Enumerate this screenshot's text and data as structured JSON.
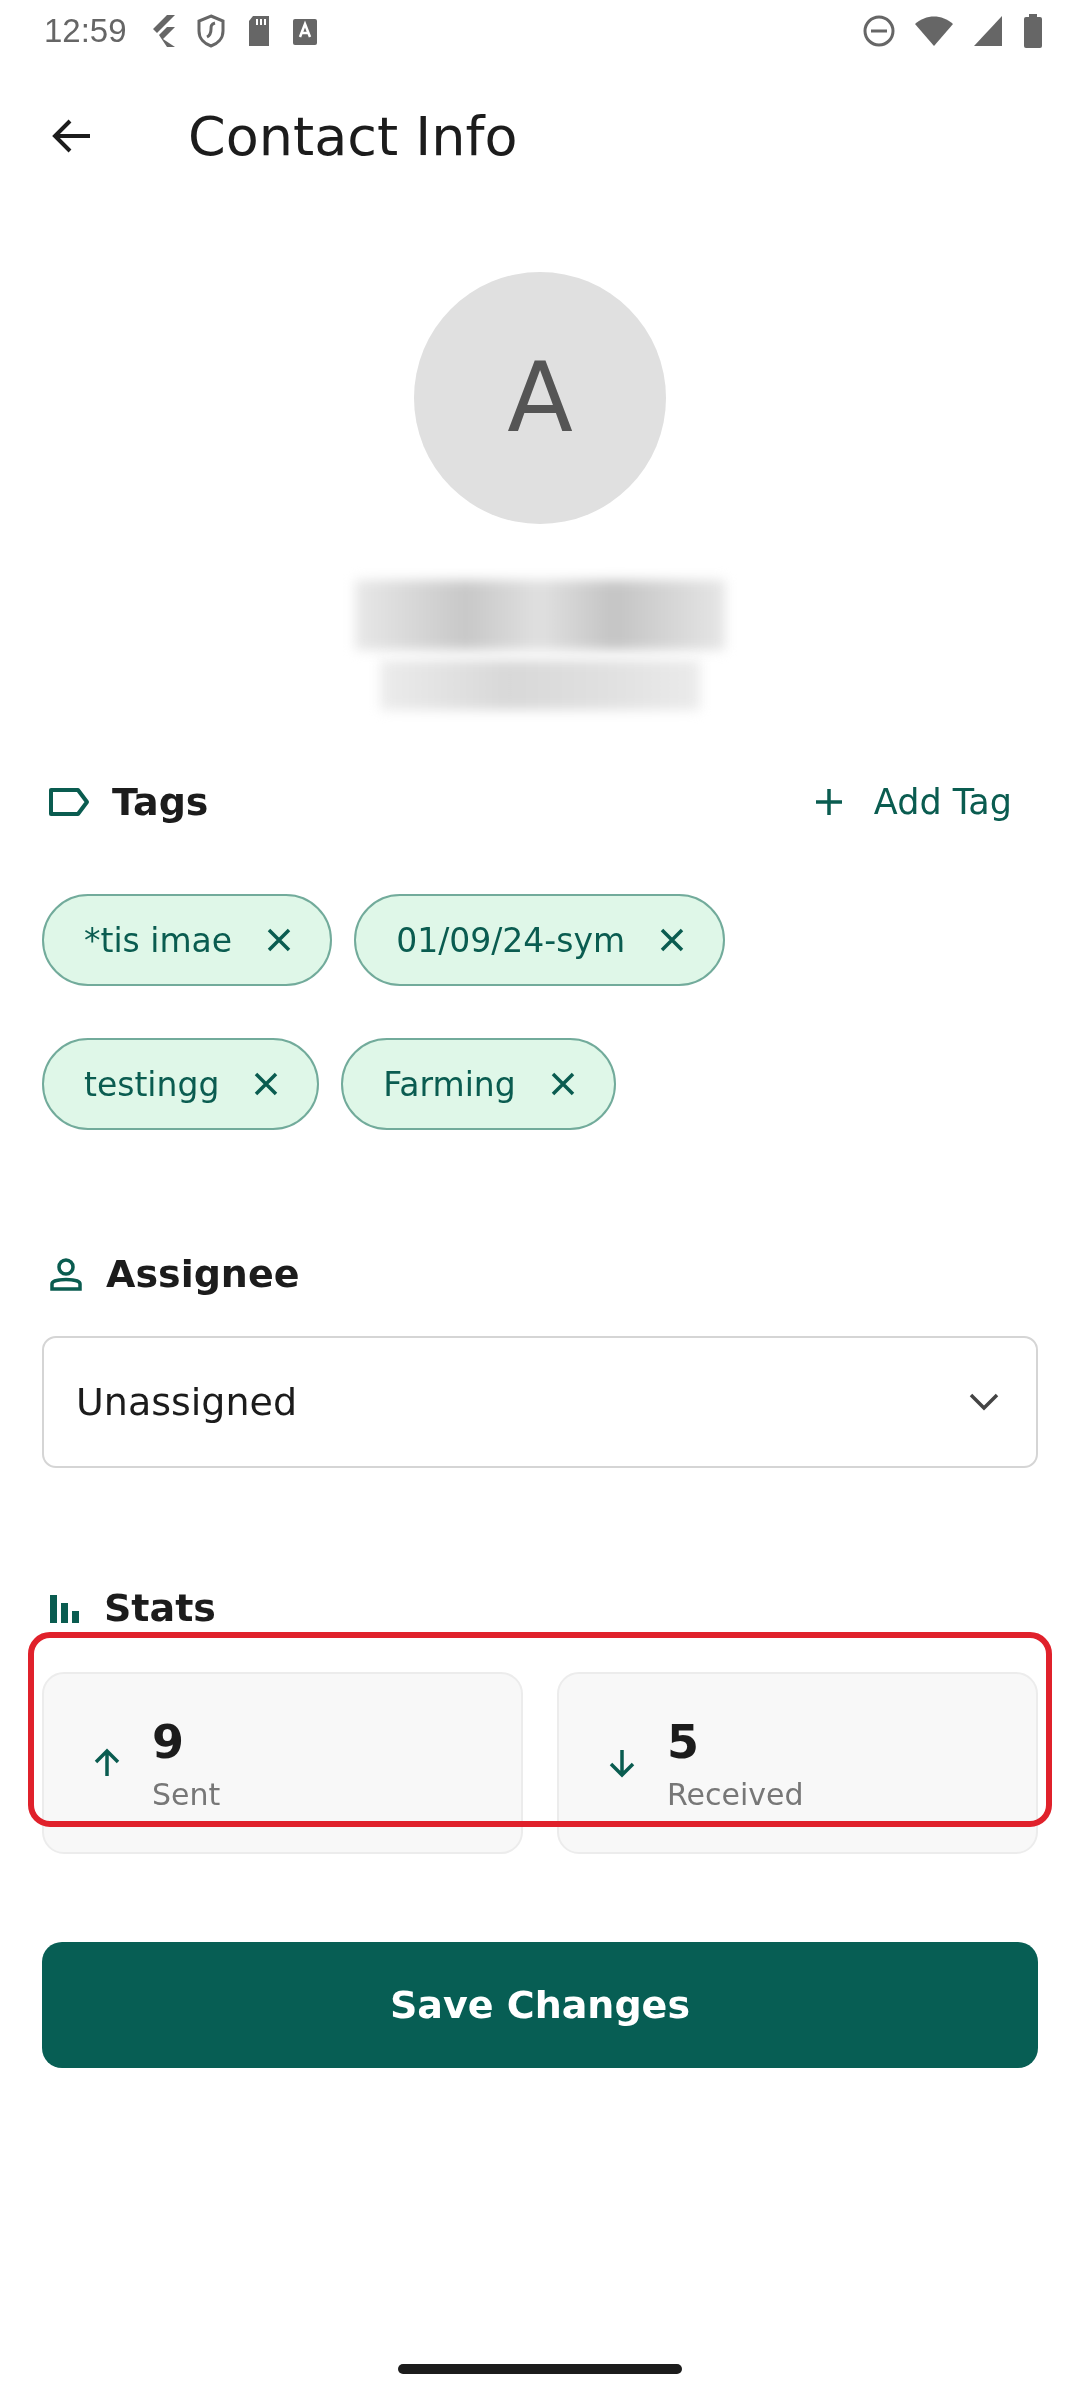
{
  "status_bar": {
    "time": "12:59"
  },
  "app_bar": {
    "title": "Contact Info"
  },
  "profile": {
    "avatar_letter": "A"
  },
  "tags": {
    "title": "Tags",
    "add_label": "Add Tag",
    "items": [
      {
        "label": "*tis imae"
      },
      {
        "label": "01/09/24-sym"
      },
      {
        "label": "testingg"
      },
      {
        "label": "Farming"
      }
    ]
  },
  "assignee": {
    "title": "Assignee",
    "value": "Unassigned"
  },
  "stats": {
    "title": "Stats",
    "highlighted": true,
    "items": [
      {
        "kind": "sent",
        "value": "9",
        "label": "Sent"
      },
      {
        "kind": "received",
        "value": "5",
        "label": "Received"
      }
    ]
  },
  "save_button": "Save Changes"
}
